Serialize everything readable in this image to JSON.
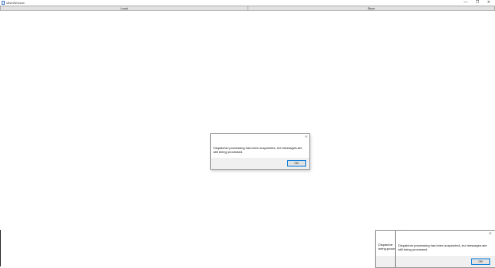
{
  "window": {
    "title": "MainWindow",
    "minimize_glyph": "—",
    "maximize_glyph": "❐",
    "close_glyph": "✕"
  },
  "toolbar": {
    "load_label": "Load",
    "save_label": "Save"
  },
  "dialog": {
    "message": "Dispatcher processing has been suspended, but messages are still being processed.",
    "ok_label": "OK",
    "close_glyph": "✕"
  },
  "dialog_back": {
    "message_partial": "Dispatche being proce"
  }
}
